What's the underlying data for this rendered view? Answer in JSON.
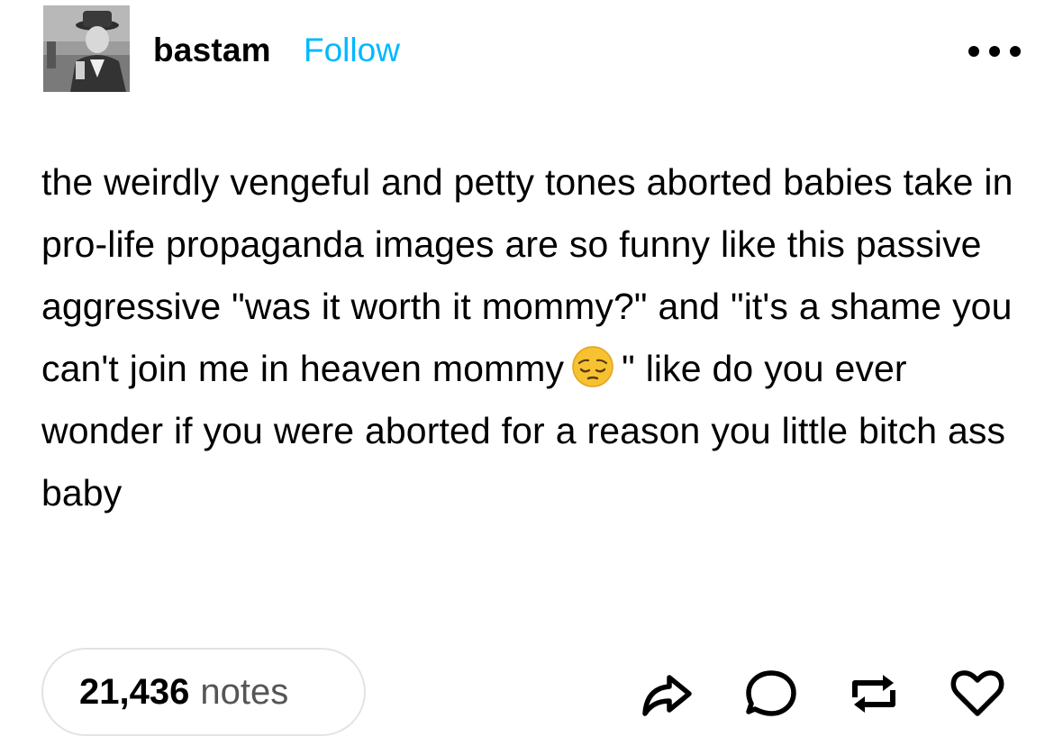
{
  "header": {
    "username": "bastam",
    "follow_label": "Follow",
    "avatar_icon": "avatar-photo",
    "more_icon": "more-horizontal-icon"
  },
  "post": {
    "text_part1": "the weirdly vengeful and petty tones aborted babies take in pro-life propaganda images are so funny like this passive aggressive \"was it worth it mommy?\" and \"it's a shame you can't join me in heaven mommy",
    "emoji": "pensive-face-emoji",
    "text_part2": "\" like do you ever wonder if you were aborted for a reason you little bitch ass baby"
  },
  "footer": {
    "notes_count": "21,436",
    "notes_label": "notes",
    "actions": [
      "share-icon",
      "reply-icon",
      "reblog-icon",
      "like-icon"
    ]
  },
  "colors": {
    "follow": "#00b8ff",
    "notes_label": "#555555",
    "border": "#e3e3e3",
    "icon": "#000000"
  }
}
